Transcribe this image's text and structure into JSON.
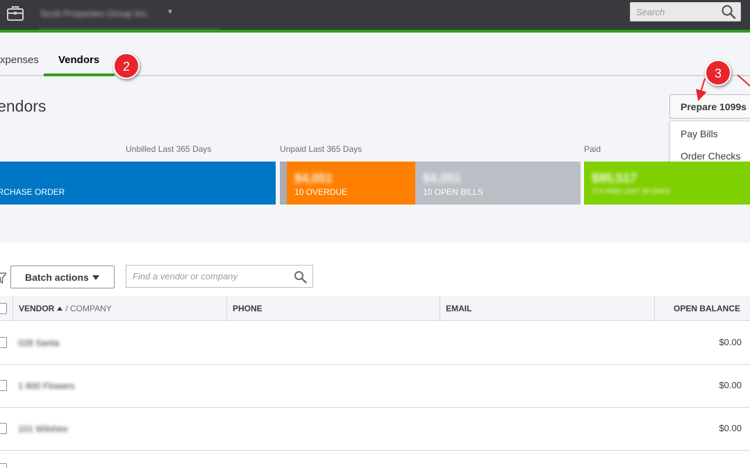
{
  "header": {
    "company_name": "Scott Properties Group Inc.",
    "search_placeholder": "Search"
  },
  "tabs": [
    {
      "label": "Expenses"
    },
    {
      "label": "Vendors",
      "active": true
    }
  ],
  "page": {
    "title": "Vendors"
  },
  "callouts": [
    "2",
    "3"
  ],
  "actions": {
    "primary_label": "Prepare 1099s",
    "menu_items": [
      "Pay Bills",
      "Order Checks"
    ]
  },
  "money_bar": {
    "labels": {
      "unbilled": "Unbilled Last 365 Days",
      "unpaid": "Unpaid Last 365 Days",
      "paid": "Paid"
    },
    "segments": {
      "purchase_order": {
        "caption": "PURCHASE ORDER"
      },
      "overdue": {
        "amount": "$4,051",
        "caption": "10 OVERDUE"
      },
      "open_bills": {
        "amount": "$4,051",
        "caption": "10 OPEN BILLS"
      },
      "paid": {
        "amount": "$95,517",
        "caption": "274 PAID LAST 30 DAYS"
      }
    },
    "colors": {
      "purchase_order": "#0077c5",
      "overdue": "#ff8000",
      "open_bills": "#babec5",
      "paid": "#7fd000"
    }
  },
  "toolbar": {
    "batch_label": "Batch actions",
    "search_placeholder": "Find a vendor or company"
  },
  "table": {
    "columns": {
      "vendor": "VENDOR",
      "company": "/ COMPANY",
      "phone": "PHONE",
      "email": "EMAIL",
      "open_balance": "OPEN BALANCE"
    },
    "rows": [
      {
        "name": "028 Santa",
        "balance": "$0.00"
      },
      {
        "name": "1 800 Flowers",
        "balance": "$0.00"
      },
      {
        "name": "101 Wilshire",
        "balance": "$0.00"
      }
    ]
  }
}
